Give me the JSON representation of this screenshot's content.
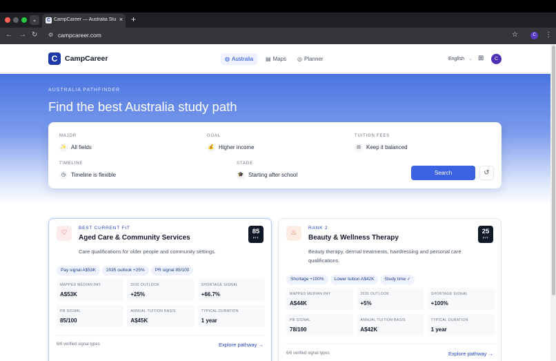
{
  "browser": {
    "tab_title": "CampCareer — Australia Study",
    "new_tab": "+",
    "url": "campcareer.com",
    "profile_initial": "C"
  },
  "header": {
    "logo_letter": "C",
    "brand": "CampCareer",
    "nav": [
      {
        "label": "Australia",
        "icon": "globe-icon",
        "active": true
      },
      {
        "label": "Maps",
        "icon": "map-icon",
        "active": false
      },
      {
        "label": "Planner",
        "icon": "compass-icon",
        "active": false
      }
    ],
    "language": "English",
    "avatar_initial": "C"
  },
  "hero": {
    "eyebrow": "AUSTRALIA PATHFINDER",
    "title": "Find the best Australia study path"
  },
  "search": {
    "fields": {
      "major": {
        "label": "MAJOR",
        "value": "All fields",
        "icon": "sparkle-icon"
      },
      "goal": {
        "label": "GOAL",
        "value": "Higher income",
        "icon": "money-bag-icon"
      },
      "tuition": {
        "label": "TUITION FEES",
        "value": "Keep it balanced",
        "icon": "scale-icon"
      },
      "timeline": {
        "label": "TIMELINE",
        "value": "Timeline is flexible",
        "icon": "clock-icon"
      },
      "stage": {
        "label": "STAGE",
        "value": "Starting after school",
        "icon": "graduation-cap-icon"
      }
    },
    "button": "Search"
  },
  "cards": [
    {
      "kicker": "BEST CURRENT FIT",
      "title": "Aged Care & Community Services",
      "description": "Care qualifications for older people and community settings.",
      "score": "85",
      "score_label": "FIT",
      "icon": "heart-pulse-icon",
      "chips": [
        "Pay signal A$53K",
        "2035 outlook +25%",
        "PR signal 85/100"
      ],
      "stats": [
        {
          "label": "MAPPED MEDIAN PAY",
          "value": "A$53K"
        },
        {
          "label": "2035 OUTLOOK",
          "value": "+25%"
        },
        {
          "label": "SHORTAGE SIGNAL",
          "value": "+66.7%"
        },
        {
          "label": "PR SIGNAL",
          "value": "85/100"
        },
        {
          "label": "ANNUAL TUITION BASIS",
          "value": "A$45K"
        },
        {
          "label": "TYPICAL DURATION",
          "value": "1 year"
        }
      ],
      "footer": "6/6 verified signal types",
      "link": "Explore pathway →"
    },
    {
      "kicker": "RANK 2",
      "title": "Beauty & Wellness Therapy",
      "description": "Beauty therapy, dermal treatments, hairdressing and personal care qualifications.",
      "score": "25",
      "score_label": "FIT",
      "icon": "spa-icon",
      "chips": [
        "Shortage +100%",
        "Lower tuition A$42K",
        "Study time ✓"
      ],
      "stats": [
        {
          "label": "MAPPED MEDIAN PAY",
          "value": "A$44K"
        },
        {
          "label": "2035 OUTLOOK",
          "value": "+5%"
        },
        {
          "label": "SHORTAGE SIGNAL",
          "value": "+100%"
        },
        {
          "label": "PR SIGNAL",
          "value": "78/100"
        },
        {
          "label": "ANNUAL TUITION BASIS",
          "value": "A$42K"
        },
        {
          "label": "TYPICAL DURATION",
          "value": "1 year"
        }
      ],
      "footer": "6/6 verified signal types",
      "link": "Explore pathway →"
    }
  ]
}
